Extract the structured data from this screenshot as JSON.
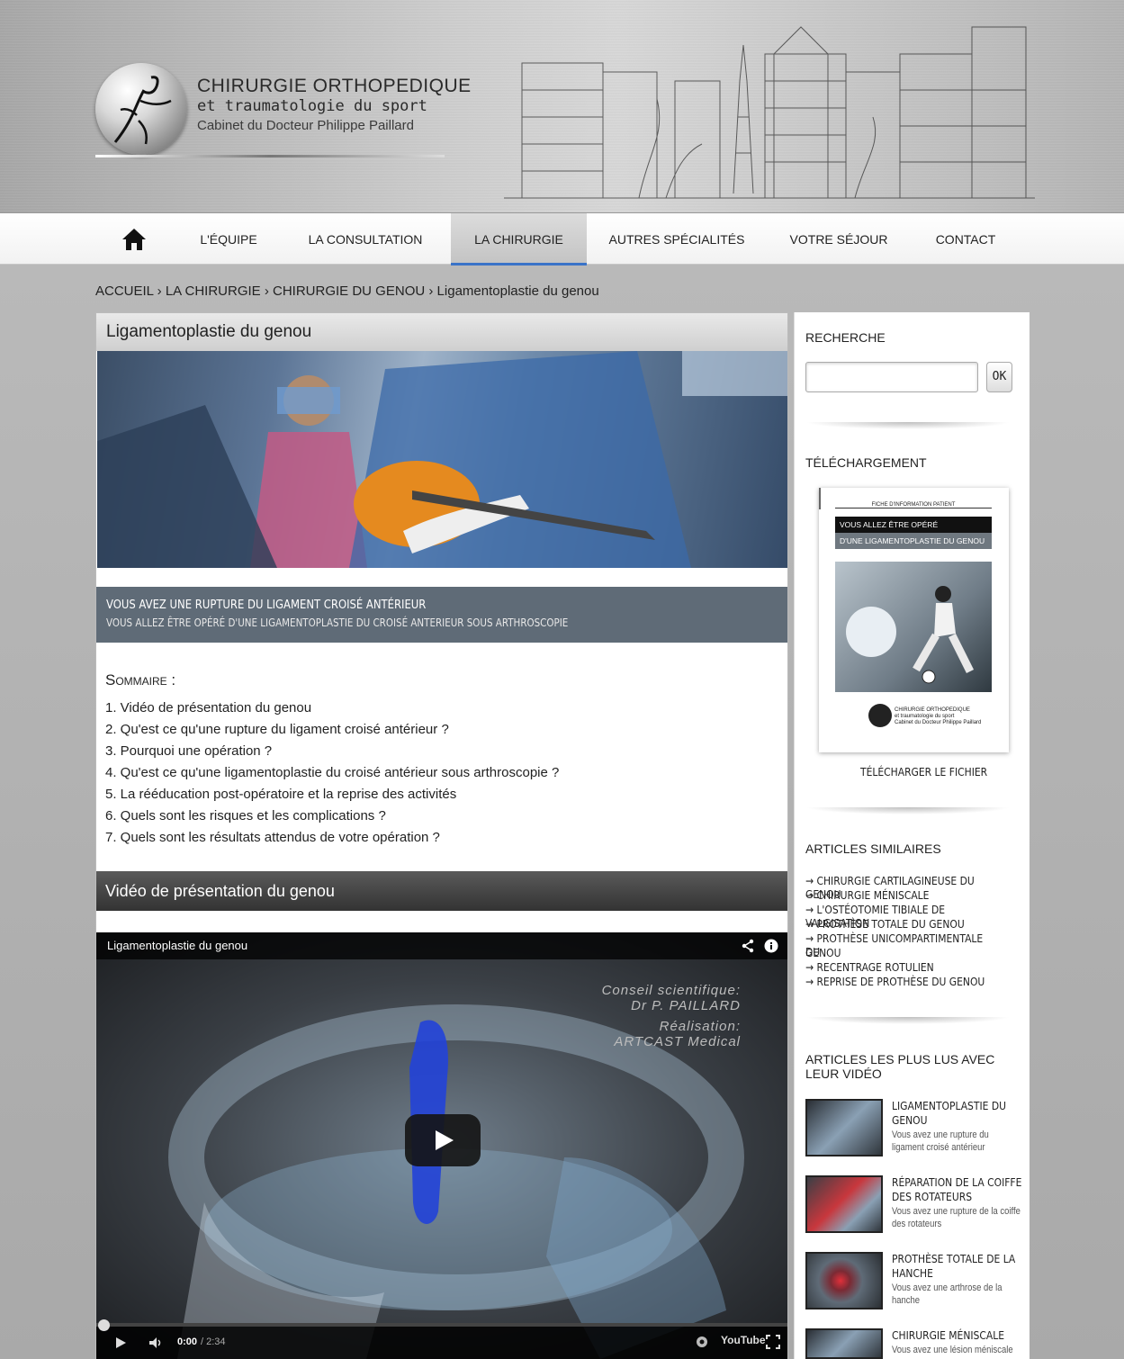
{
  "header": {
    "title": "CHIRURGIE ORTHOPEDIQUE",
    "subtitle": "et traumatologie du sport",
    "cabinet": "Cabinet du Docteur Philippe Paillard"
  },
  "nav": {
    "items": [
      {
        "label": "L'ÉQUIPE"
      },
      {
        "label": "LA CONSULTATION"
      },
      {
        "label": "LA CHIRURGIE"
      },
      {
        "label": "AUTRES SPÉCIALITÉS"
      },
      {
        "label": "VOTRE SÉJOUR"
      },
      {
        "label": "CONTACT"
      }
    ],
    "active": "LA CHIRURGIE"
  },
  "breadcrumb": {
    "home": "ACCUEIL",
    "sep": "›",
    "level1": "LA CHIRURGIE",
    "level2": "CHIRURGIE DU GENOU",
    "current": "Ligamentoplastie du genou"
  },
  "article": {
    "title": "Ligamentoplastie du genou",
    "banner_title": "VOUS AVEZ UNE RUPTURE DU LIGAMENT CROISÉ ANTÉRIEUR",
    "banner_sub": "VOUS ALLEZ ÊTRE OPÉRÉ D'UNE LIGAMENTOPLASTIE DU CROISÉ ANTERIEUR SOUS ARTHROSCOPIE",
    "sommaire_title": "Sommaire :",
    "toc": [
      "1. Vidéo de présentation du genou",
      "2. Qu'est ce qu'une rupture du ligament croisé antérieur ?",
      "3. Pourquoi une opération ?",
      "4. Qu'est ce qu'une ligamentoplastie du croisé antérieur sous arthroscopie ?",
      "5. La rééducation post-opératoire et la reprise des activités",
      "6. Quels sont les risques et les complications ?",
      "7. Quels sont les résultats attendus de votre opération ?"
    ],
    "video_section_title": "Vidéo de présentation du genou"
  },
  "video": {
    "title": "Ligamentoplastie du genou",
    "credit_1": "Conseil scientifique:",
    "credit_2": "Dr P. PAILLARD",
    "credit_3": "Réalisation:",
    "credit_4": "ARTCAST Medical",
    "time_current": "0:00",
    "time_total": "/ 2:34",
    "brand": "YouTube",
    "progress": 0
  },
  "sidebar": {
    "search_heading": "RECHERCHE",
    "search_value": "",
    "search_button": "OK",
    "download_heading": "TÉLÉCHARGEMENT",
    "doc_header": "FICHE D'INFORMATION PATIENT",
    "doc_line1": "VOUS ALLEZ ÊTRE OPÉRÉ",
    "doc_line2": "D'UNE LIGAMENTOPLASTIE DU GENOU",
    "doc_footer_1": "CHIRURGIE ORTHOPEDIQUE",
    "doc_footer_2": "et traumatologie du sport",
    "doc_footer_3": "Cabinet du Docteur Philippe Paillard",
    "download_link": "TÉLÉCHARGER LE FICHIER",
    "similar_heading": "ARTICLES SIMILAIRES",
    "similar": [
      "CHIRURGIE CARTILAGINEUSE DU GENOU",
      "CHIRURGIE MÉNISCALE",
      "L'OSTÉOTOMIE TIBIALE DE VALGISATION",
      "PROTHÈSE TOTALE DU GENOU",
      "PROTHÈSE UNICOMPARTIMENTALE DU",
      "GENOU",
      "RECENTRAGE ROTULIEN",
      "REPRISE DE PROTHÈSE DU GENOU"
    ],
    "most_read_heading_1": "ARTICLES LES PLUS LUS AVEC",
    "most_read_heading_2": "LEUR VIDÉO",
    "most_read": [
      {
        "title_1": "LIGAMENTOPLASTIE DU",
        "title_2": "GENOU",
        "desc_1": "Vous avez une rupture du",
        "desc_2": "ligament croisé antérieur"
      },
      {
        "title_1": "RÉPARATION DE LA COIFFE",
        "title_2": "DES ROTATEURS",
        "desc_1": "Vous avez une rupture de la coiffe",
        "desc_2": "des rotateurs"
      },
      {
        "title_1": "PROTHÈSE TOTALE DE LA",
        "title_2": "HANCHE",
        "desc_1": "Vous avez une arthrose de la",
        "desc_2": "hanche"
      },
      {
        "title_1": "CHIRURGIE MÉNISCALE",
        "title_2": "",
        "desc_1": "Vous avez une lésion méniscale",
        "desc_2": ""
      }
    ],
    "arrow": "→"
  },
  "colors": {
    "nav_active_underline": "#3a73c8",
    "banner_bg": "#5f6b77",
    "dark_bar": "#333333"
  }
}
